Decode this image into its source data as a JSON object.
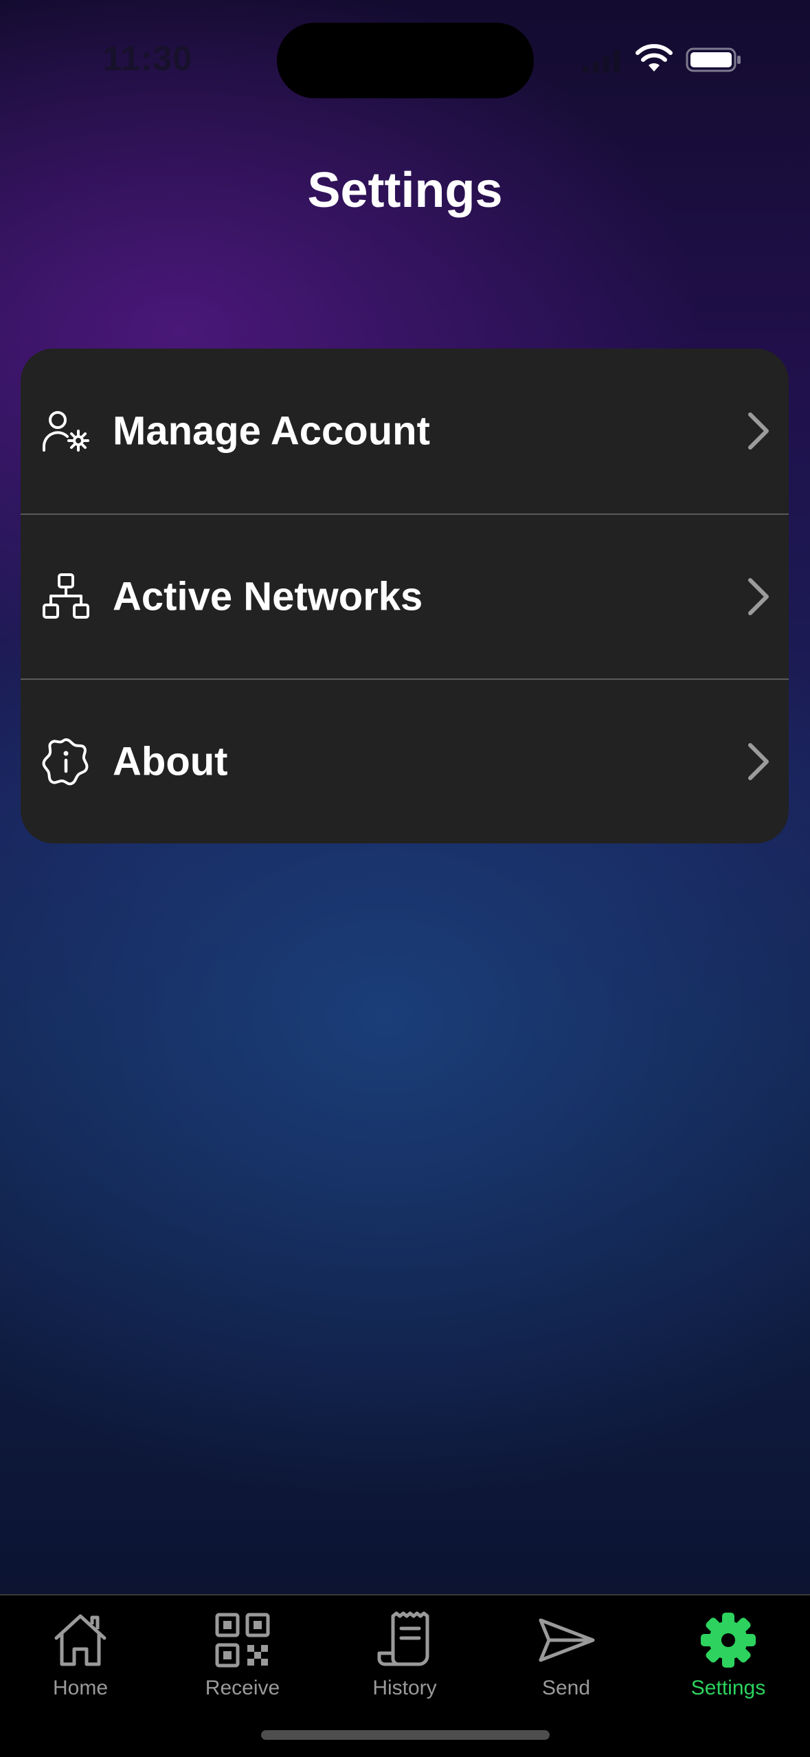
{
  "status_bar": {
    "time": "11:30",
    "icons": [
      "cellular-signal-icon",
      "wifi-icon",
      "battery-icon"
    ]
  },
  "header": {
    "title": "Settings"
  },
  "settings_list": {
    "items": [
      {
        "label": "Manage Account",
        "icon": "user-gear-icon"
      },
      {
        "label": "Active Networks",
        "icon": "network-icon"
      },
      {
        "label": "About",
        "icon": "info-badge-icon"
      }
    ]
  },
  "tab_bar": {
    "items": [
      {
        "label": "Home",
        "icon": "home-icon",
        "active": false
      },
      {
        "label": "Receive",
        "icon": "qr-code-icon",
        "active": false
      },
      {
        "label": "History",
        "icon": "receipt-icon",
        "active": false
      },
      {
        "label": "Send",
        "icon": "paper-plane-icon",
        "active": false
      },
      {
        "label": "Settings",
        "icon": "gear-icon",
        "active": true
      }
    ]
  },
  "colors": {
    "accent": "#2dd35e",
    "card_background": "#222222",
    "tab_inactive": "#9a9a9a",
    "tab_bar_background": "#000000"
  }
}
